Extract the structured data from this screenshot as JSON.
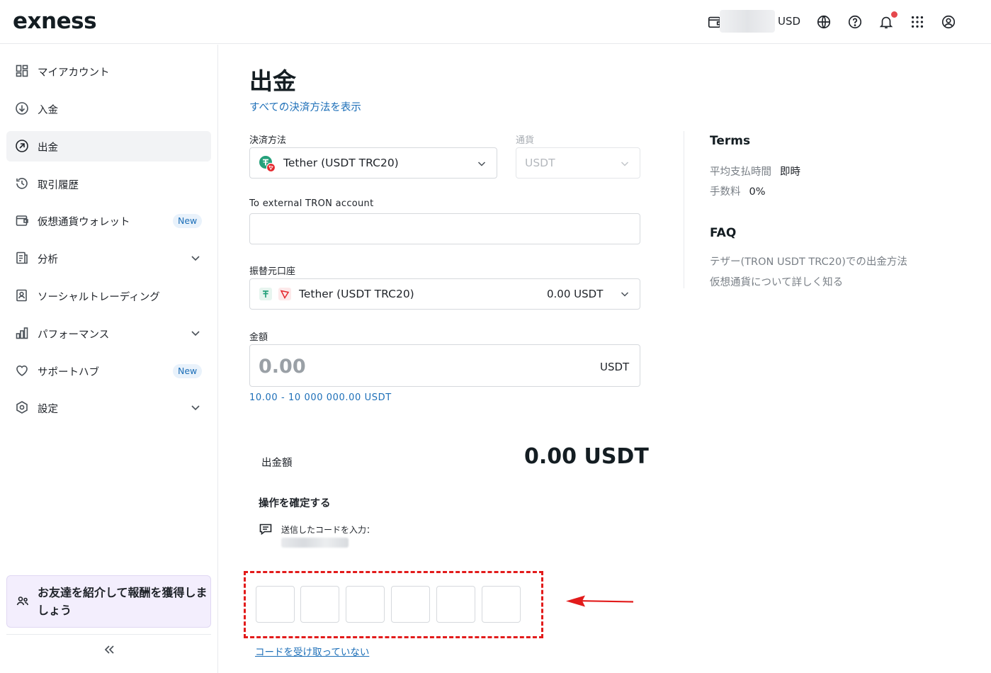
{
  "header": {
    "logo": "exness",
    "currency": "USD",
    "icons": [
      "wallet-icon",
      "globe-icon",
      "help-icon",
      "bell-icon",
      "apps-grid-icon",
      "account-icon"
    ]
  },
  "sidebar": {
    "items": [
      {
        "label": "マイアカウント",
        "icon": "dashboard-icon"
      },
      {
        "label": "入金",
        "icon": "deposit-icon"
      },
      {
        "label": "出金",
        "icon": "withdraw-icon",
        "active": true
      },
      {
        "label": "取引履歴",
        "icon": "history-icon"
      },
      {
        "label": "仮想通貨ウォレット",
        "icon": "wallet-icon",
        "badge": "New"
      },
      {
        "label": "分析",
        "icon": "analytics-icon",
        "expandable": true
      },
      {
        "label": "ソーシャルトレーディング",
        "icon": "social-trading-icon"
      },
      {
        "label": "パフォーマンス",
        "icon": "performance-icon",
        "expandable": true
      },
      {
        "label": "サポートハブ",
        "icon": "heart-icon",
        "badge": "New"
      },
      {
        "label": "設定",
        "icon": "settings-icon",
        "expandable": true
      }
    ],
    "promo": "お友達を紹介して報酬を獲得しましょう",
    "collapse_icon": "double-chevron-left-icon"
  },
  "main": {
    "title": "出金",
    "show_all_methods": "すべての決済方法を表示",
    "payment_method": {
      "label": "決済方法",
      "value": "Tether (USDT TRC20)"
    },
    "currency": {
      "label": "通貨",
      "value": "USDT"
    },
    "external_account": {
      "label": "To external TRON account",
      "value": ""
    },
    "source_account": {
      "label": "振替元口座",
      "name": "Tether (USDT TRC20)",
      "balance": "0.00 USDT"
    },
    "amount": {
      "label": "金額",
      "value": "0.00",
      "currency": "USDT",
      "range": "10.00 - 10 000 000.00 USDT"
    },
    "withdraw_amount": {
      "label": "出金額",
      "value": "0.00 USDT"
    },
    "confirm": {
      "title": "操作を確定する",
      "sms_text": "送信したコードを入力：",
      "code_boxes": [
        "",
        "",
        "",
        "",
        "",
        ""
      ],
      "no_code_link": "コードを受け取っていない"
    }
  },
  "right_panel": {
    "terms_title": "Terms",
    "terms": [
      {
        "key": "平均支払時間",
        "value": "即時"
      },
      {
        "key": "手数料",
        "value": "0%"
      }
    ],
    "faq_title": "FAQ",
    "faq_links": [
      "テザー(TRON USDT TRC20)での出金方法",
      "仮想通貨について詳しく知る"
    ]
  },
  "colors": {
    "accent_link": "#1d6fb8",
    "highlight": "#e21b1b",
    "tether_green": "#26a17b",
    "tron_red": "#e5272d"
  }
}
